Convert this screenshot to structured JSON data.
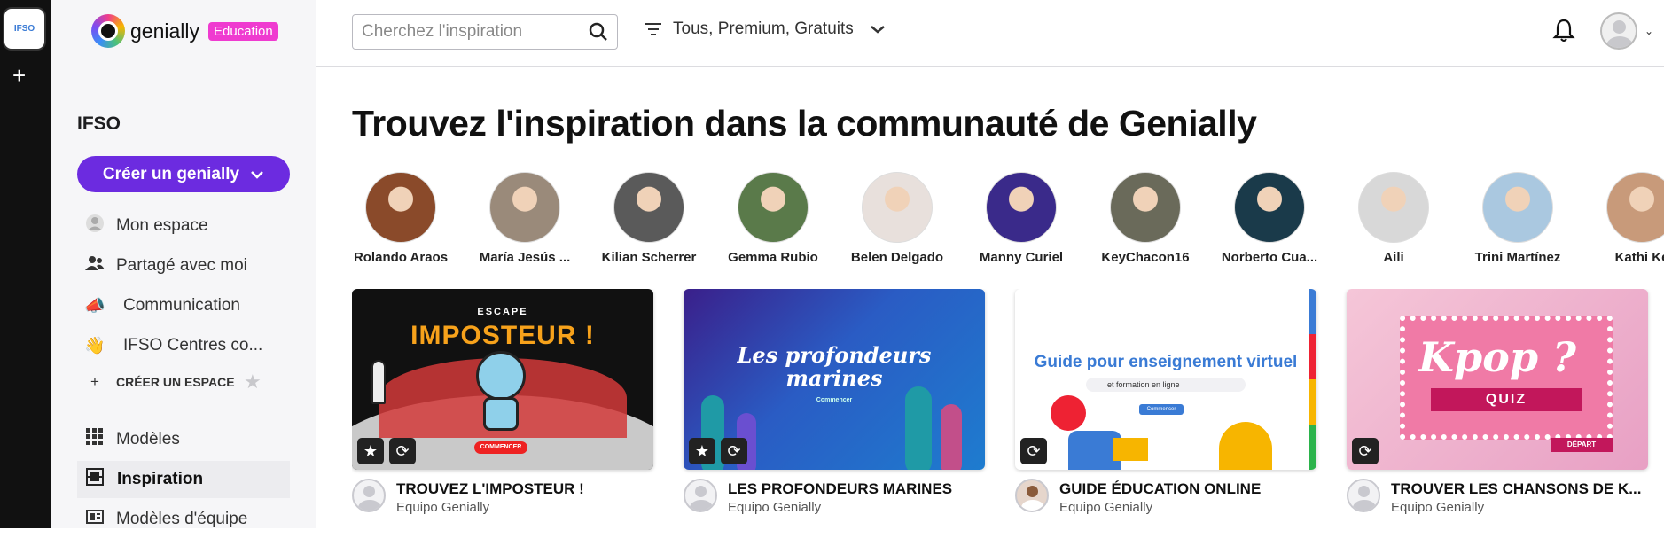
{
  "rail": {
    "workspace_logo_text": "IFSO",
    "add_symbol": "+"
  },
  "brand": {
    "name": "genially",
    "badge": "Education"
  },
  "sidebar": {
    "workspace_name": "IFSO",
    "create_label": "Créer un genially",
    "items": [
      {
        "label": "Mon espace",
        "icon": "user-circle-icon"
      },
      {
        "label": "Partagé avec moi",
        "icon": "people-icon"
      },
      {
        "label": "Communication",
        "icon": "megaphone-icon"
      },
      {
        "label": "IFSO Centres co...",
        "icon": "waving-hand-icon"
      },
      {
        "label": "CRÉER UN ESPACE",
        "icon": "plus-icon"
      },
      {
        "label": "Modèles",
        "icon": "grid-icon"
      },
      {
        "label": "Inspiration",
        "icon": "inspiration-icon"
      },
      {
        "label": "Modèles d'équipe",
        "icon": "team-templates-icon"
      }
    ]
  },
  "topbar": {
    "search_placeholder": "Cherchez l'inspiration",
    "filter_label": "Tous, Premium, Gratuits"
  },
  "main": {
    "title": "Trouvez l'inspiration dans la communauté de Genially",
    "creators": [
      {
        "name": "Rolando Araos",
        "color": "#8a4a2a"
      },
      {
        "name": "María Jesús ...",
        "color": "#9a8a7a"
      },
      {
        "name": "Kilian Scherrer",
        "color": "#5a5a5a"
      },
      {
        "name": "Gemma Rubio",
        "color": "#5a7a4a"
      },
      {
        "name": "Belen Delgado",
        "color": "#e8e0dc"
      },
      {
        "name": "Manny Curiel",
        "color": "#3a2a8a"
      },
      {
        "name": "KeyChacon16",
        "color": "#6a6a5a"
      },
      {
        "name": "Norberto Cua...",
        "color": "#1a3a4a"
      },
      {
        "name": "Aili",
        "color": "#d8d8d8"
      },
      {
        "name": "Trini Martínez",
        "color": "#aac8e0"
      },
      {
        "name": "Kathi Ke",
        "color": "#c89a7a"
      }
    ],
    "cards": [
      {
        "title": "TROUVEZ L'IMPOSTEUR !",
        "author": "Equipo Genially",
        "thumb_small": "ESCAPE",
        "thumb_big": "IMPOSTEUR !",
        "thumb_btn": "COMMENCER"
      },
      {
        "title": "LES PROFONDEURS MARINES",
        "author": "Equipo Genially",
        "thumb_big": "Les profondeurs marines",
        "thumb_small": "Commencer"
      },
      {
        "title": "GUIDE ÉDUCATION ONLINE",
        "author": "Equipo Genially",
        "thumb_big": "Guide pour enseignement virtuel",
        "thumb_small": "et formation en ligne",
        "thumb_btn": "Commencer"
      },
      {
        "title": "TROUVER LES CHANSONS DE K...",
        "author": "Equipo Genially",
        "thumb_big": "Kpop ?",
        "thumb_small": "QUIZ",
        "thumb_btn": "DÉPART"
      }
    ]
  }
}
